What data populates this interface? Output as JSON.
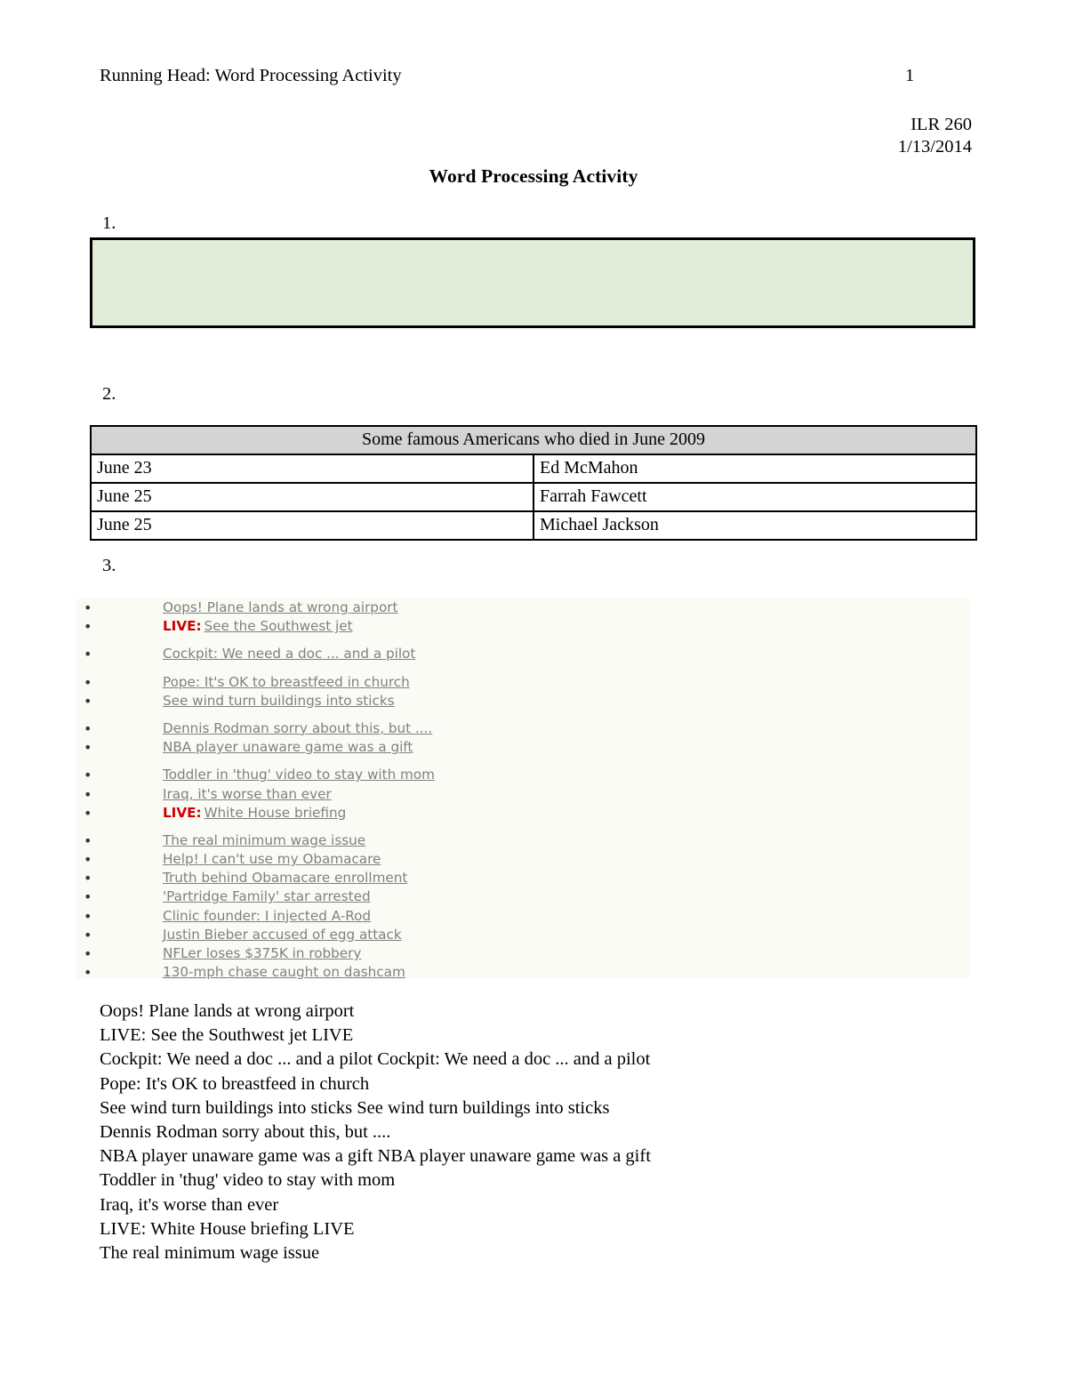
{
  "header": {
    "running_head": "Running Head: Word Processing Activity",
    "page_number": "1",
    "course": "ILR 260",
    "date": "1/13/2014",
    "title": "Word Processing Activity"
  },
  "items": {
    "one_label": "1.",
    "two_label": "2.",
    "three_label": "3."
  },
  "green_box": {
    "fill_color": "#E2EDD9",
    "border_color": "#000000",
    "content": ""
  },
  "table": {
    "caption": "Some famous Americans who died in June 2009",
    "header_fill": "#D4D4D4",
    "rows": [
      {
        "date": "June 23",
        "name": "Ed McMahon"
      },
      {
        "date": "June 25",
        "name": "Farrah Fawcett"
      },
      {
        "date": "June 25",
        "name": "Michael Jackson"
      }
    ]
  },
  "headlines": {
    "background": "#FBFBF5",
    "link_color": "#808080",
    "live_color": "#CC0000",
    "live_prefix": "LIVE:",
    "items": [
      {
        "text": "Oops! Plane lands at wrong airport",
        "live": false,
        "gap_before": false
      },
      {
        "text": "See the Southwest jet",
        "live": true,
        "gap_before": false
      },
      {
        "text": "Cockpit: We need a doc ... and a pilot",
        "live": false,
        "gap_before": true
      },
      {
        "text": "Pope: It's OK to breastfeed in church",
        "live": false,
        "gap_before": true
      },
      {
        "text": "See wind turn buildings into sticks",
        "live": false,
        "gap_before": false
      },
      {
        "text": "Dennis Rodman sorry about this, but ....",
        "live": false,
        "gap_before": true
      },
      {
        "text": "NBA player unaware game was a gift",
        "live": false,
        "gap_before": false
      },
      {
        "text": "Toddler in 'thug' video to stay with mom",
        "live": false,
        "gap_before": true
      },
      {
        "text": "Iraq, it's worse than ever",
        "live": false,
        "gap_before": false
      },
      {
        "text": "White House briefing",
        "live": true,
        "gap_before": false
      },
      {
        "text": "The real minimum wage issue",
        "live": false,
        "gap_before": true
      },
      {
        "text": "Help! I can't use my Obamacare",
        "live": false,
        "gap_before": false
      },
      {
        "text": "Truth behind Obamacare enrollment",
        "live": false,
        "gap_before": false
      },
      {
        "text": "'Partridge Family' star arrested",
        "live": false,
        "gap_before": false
      },
      {
        "text": "Clinic founder: I injected A-Rod",
        "live": false,
        "gap_before": false
      },
      {
        "text": "Justin Bieber accused of egg attack",
        "live": false,
        "gap_before": false
      },
      {
        "text": "NFLer loses $375K in robbery",
        "live": false,
        "gap_before": false
      },
      {
        "text": "130-mph chase caught on dashcam",
        "live": false,
        "gap_before": false
      }
    ]
  },
  "plain_text": {
    "lines": [
      "Oops! Plane lands at wrong airport",
      "LIVE: See the Southwest jet  LIVE",
      "Cockpit: We need a doc ... and a pilot  Cockpit: We need a doc ... and a pilot",
      "Pope: It's OK to breastfeed in church",
      "See wind turn buildings into sticks  See wind turn buildings into sticks",
      "Dennis Rodman sorry about this, but ....",
      "NBA player unaware game was a gift  NBA player unaware game was a gift",
      "Toddler in 'thug' video to stay with mom",
      "Iraq, it's worse than ever",
      "LIVE: White House briefing  LIVE",
      "The real minimum wage issue"
    ]
  }
}
